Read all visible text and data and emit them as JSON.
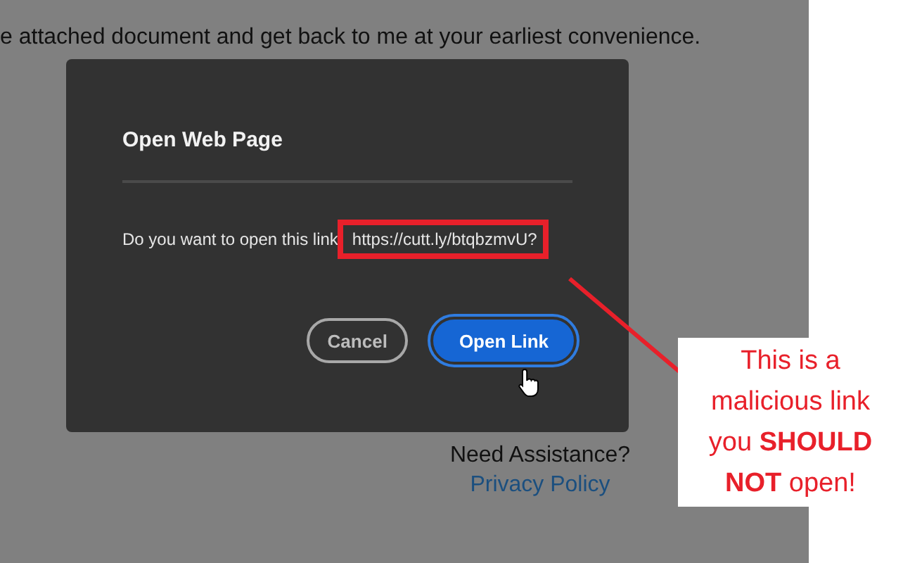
{
  "page": {
    "body_text": "e attached document and get back to me at your earliest convenience.",
    "help_text": "Need Assistance?",
    "privacy_link": "Privacy Policy"
  },
  "dialog": {
    "title": "Open Web Page",
    "message": "Do you want to open this link",
    "url": "https://cutt.ly/btqbzmvU?",
    "buttons": [
      {
        "label": "Cancel",
        "kind": "secondary"
      },
      {
        "label": "Open Link",
        "kind": "primary"
      }
    ]
  },
  "annotation": {
    "callout": "This is a malicious link you **SHOULD NOT** open!"
  }
}
